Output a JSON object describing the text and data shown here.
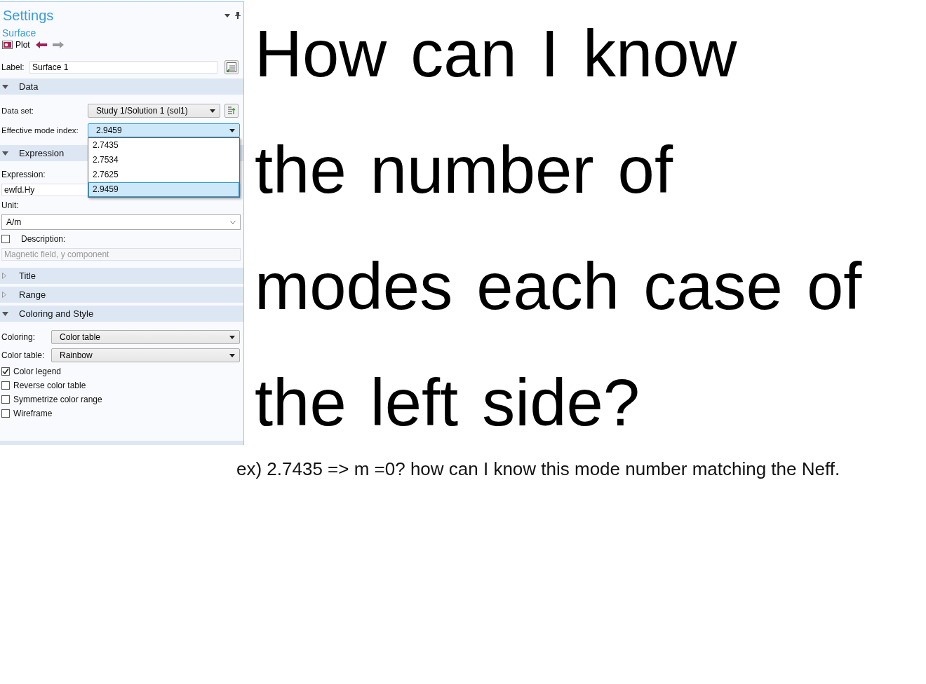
{
  "panel": {
    "title": "Settings",
    "subtitle": "Surface",
    "plot_label": "Plot",
    "label_field": {
      "label": "Label:",
      "value": "Surface 1"
    },
    "sections": [
      {
        "title": "Data",
        "expanded": true,
        "rows": [
          {
            "kind": "select_with_button",
            "label": "Data set:",
            "value": "Study 1/Solution 1 (sol1)",
            "open": false
          },
          {
            "kind": "select",
            "label": "Effective mode index:",
            "value": "2.9459",
            "open": true,
            "options": [
              {
                "label": "2.7435",
                "selected": false
              },
              {
                "label": "2.7534",
                "selected": false
              },
              {
                "label": "2.7625",
                "selected": false
              },
              {
                "label": "2.9459",
                "selected": true
              }
            ]
          }
        ]
      },
      {
        "title": "Expression",
        "expanded": true,
        "rows": [
          {
            "kind": "caption",
            "label": "Expression:"
          },
          {
            "kind": "field",
            "value": "ewfd.Hy",
            "disabled": false
          },
          {
            "kind": "caption",
            "label": "Unit:"
          },
          {
            "kind": "combo",
            "value": "A/m"
          },
          {
            "kind": "checkcaption",
            "label": "Description:",
            "checked": false
          },
          {
            "kind": "field",
            "value": "Magnetic field, y component",
            "disabled": true
          }
        ]
      },
      {
        "title": "Title",
        "expanded": false
      },
      {
        "title": "Range",
        "expanded": false
      },
      {
        "title": "Coloring and Style",
        "expanded": true,
        "rows": [
          {
            "kind": "lselect",
            "label": "Coloring:",
            "value": "Color table"
          },
          {
            "kind": "lselect",
            "label": "Color table:",
            "value": "Rainbow"
          },
          {
            "kind": "check",
            "label": "Color legend",
            "checked": true
          },
          {
            "kind": "check",
            "label": "Reverse color table",
            "checked": false
          },
          {
            "kind": "check",
            "label": "Symmetrize color range",
            "checked": false
          },
          {
            "kind": "check",
            "label": "Wireframe",
            "checked": false
          }
        ]
      }
    ]
  },
  "question": {
    "lines": [
      "How can I know",
      "the number of",
      "modes each case of",
      "the left side?"
    ],
    "note": "ex) 2.7435 => m =0? how can I know this mode number matching the Neff."
  }
}
